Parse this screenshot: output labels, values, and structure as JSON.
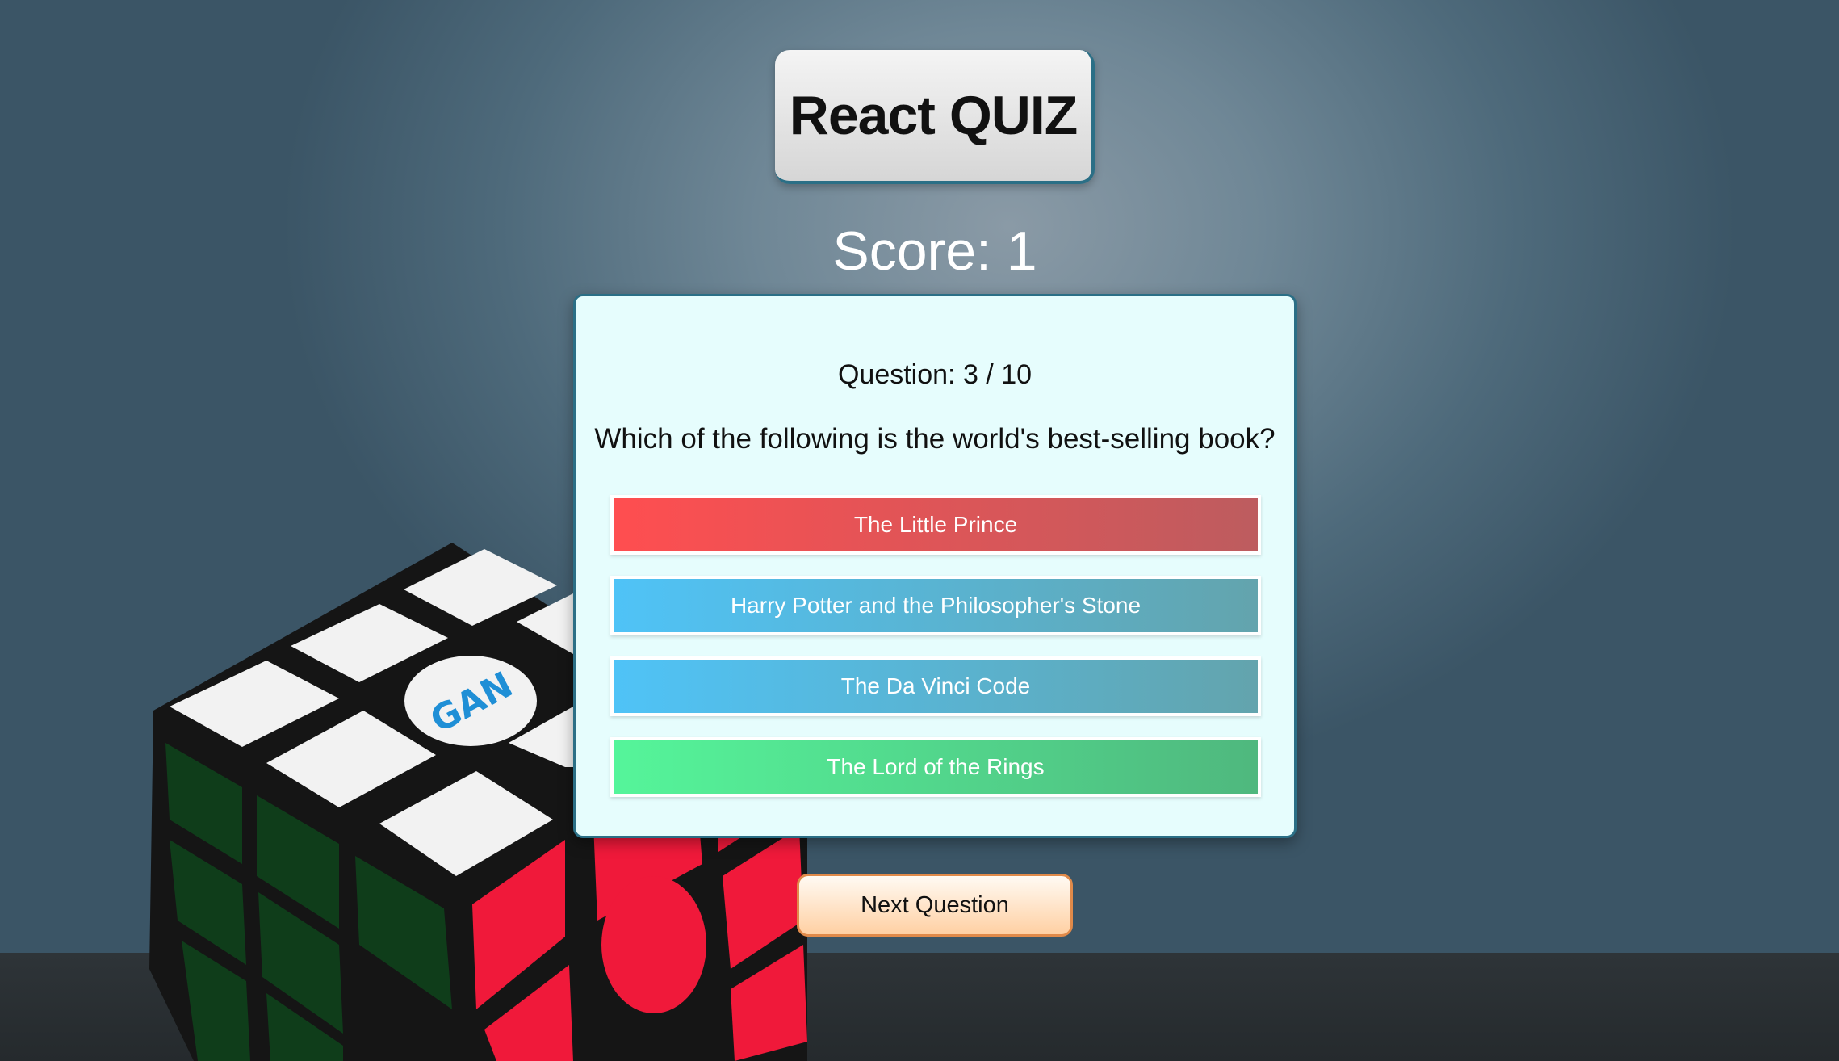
{
  "app": {
    "title": "React QUIZ",
    "score_label": "Score: 1"
  },
  "quiz": {
    "question_counter": "Question: 3 / 10",
    "question_text": "Which of the following is the world's best-selling book?",
    "answers": [
      {
        "label": "The Little Prince",
        "state": "incorrect",
        "color": "#ff4e50"
      },
      {
        "label": "Harry Potter and the Philosopher's Stone",
        "state": "neutral",
        "color": "#4fc3f7"
      },
      {
        "label": "The Da Vinci Code",
        "state": "neutral",
        "color": "#4fc3f7"
      },
      {
        "label": "The Lord of the Rings",
        "state": "correct",
        "color": "#55f59a"
      }
    ]
  },
  "controls": {
    "next_label": "Next Question"
  },
  "background": {
    "image": "rubiks-cube",
    "logo_text": "GAN"
  },
  "colors": {
    "accent_border": "#2b6f86",
    "card_bg": "#e6fdfd",
    "next_button": "#ffd0a3"
  }
}
